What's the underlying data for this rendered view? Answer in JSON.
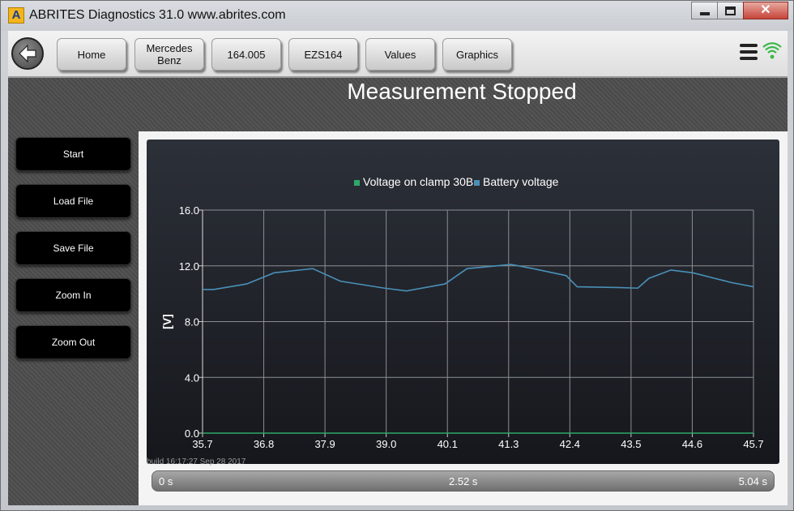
{
  "window": {
    "app_icon_letter": "A",
    "title": "ABRITES Diagnostics 31.0   www.abrites.com"
  },
  "toolbar": {
    "nav": [
      "Home",
      "Mercedes\nBenz",
      "164.005",
      "EZS164",
      "Values",
      "Graphics"
    ]
  },
  "status": {
    "title": "Measurement Stopped"
  },
  "sidebar": {
    "buttons": [
      "Start",
      "Load File",
      "Save File",
      "Zoom In",
      "Zoom Out"
    ]
  },
  "footer": {
    "build": "build 16:17:27 Sep 28 2017",
    "time_start": "0 s",
    "time_mid": "2.52 s",
    "time_end": "5.04 s"
  },
  "colors": {
    "series_green": "#2ea86a",
    "series_blue": "#4a90b8",
    "grid": "#8b8d92",
    "wifi": "#39b84a"
  },
  "chart_data": {
    "type": "line",
    "legend": [
      "Voltage on clamp 30B",
      "Battery voltage"
    ],
    "legend_position": "top-center",
    "ylabel": "[V]",
    "xlabel": "",
    "xlim": [
      35.7,
      45.7
    ],
    "ylim": [
      0,
      16
    ],
    "x_ticks": [
      "35.7",
      "36.8",
      "37.9",
      "39.0",
      "40.1",
      "41.3",
      "42.4",
      "43.5",
      "44.6",
      "45.7"
    ],
    "y_ticks": [
      "0.0",
      "4.0",
      "8.0",
      "12.0",
      "16.0"
    ],
    "grid": true,
    "series": [
      {
        "name": "Voltage on clamp 30B",
        "x": [
          35.7,
          45.7
        ],
        "y": [
          0.0,
          0.0
        ]
      },
      {
        "name": "Battery voltage",
        "x": [
          35.7,
          35.9,
          36.5,
          37.0,
          37.7,
          38.2,
          39.0,
          39.4,
          40.1,
          40.5,
          41.3,
          41.7,
          42.3,
          42.5,
          43.2,
          43.6,
          43.8,
          44.2,
          44.6,
          45.3,
          45.7
        ],
        "y": [
          10.3,
          10.3,
          10.7,
          11.5,
          11.8,
          10.9,
          10.4,
          10.2,
          10.7,
          11.8,
          12.1,
          11.8,
          11.3,
          10.5,
          10.45,
          10.4,
          11.1,
          11.7,
          11.5,
          10.8,
          10.5
        ]
      }
    ]
  }
}
